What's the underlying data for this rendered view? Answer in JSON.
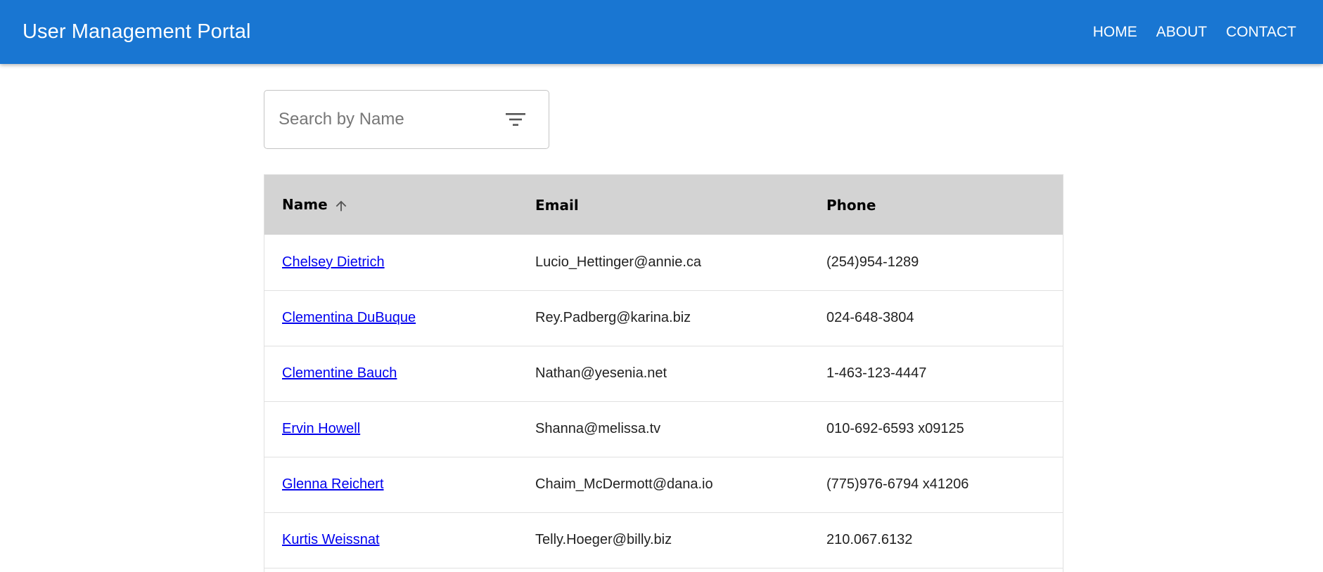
{
  "header": {
    "title": "User Management Portal",
    "nav": [
      "HOME",
      "ABOUT",
      "CONTACT"
    ],
    "background_color": "#1976d2"
  },
  "search": {
    "placeholder": "Search by Name",
    "value": "",
    "icon": "filter-icon"
  },
  "table": {
    "columns": [
      "Name",
      "Email",
      "Phone"
    ],
    "sort": {
      "column": "Name",
      "direction": "ascending",
      "icon": "arrow-up-icon"
    },
    "header_background": "#d3d3d3",
    "rows": [
      {
        "name": "Chelsey Dietrich",
        "email": "Lucio_Hettinger@annie.ca",
        "phone": "(254)954-1289"
      },
      {
        "name": "Clementina DuBuque",
        "email": "Rey.Padberg@karina.biz",
        "phone": "024-648-3804"
      },
      {
        "name": "Clementine Bauch",
        "email": "Nathan@yesenia.net",
        "phone": "1-463-123-4447"
      },
      {
        "name": "Ervin Howell",
        "email": "Shanna@melissa.tv",
        "phone": "010-692-6593 x09125"
      },
      {
        "name": "Glenna Reichert",
        "email": "Chaim_McDermott@dana.io",
        "phone": "(775)976-6794 x41206"
      },
      {
        "name": "Kurtis Weissnat",
        "email": "Telly.Hoeger@billy.biz",
        "phone": "210.067.6132"
      }
    ]
  }
}
